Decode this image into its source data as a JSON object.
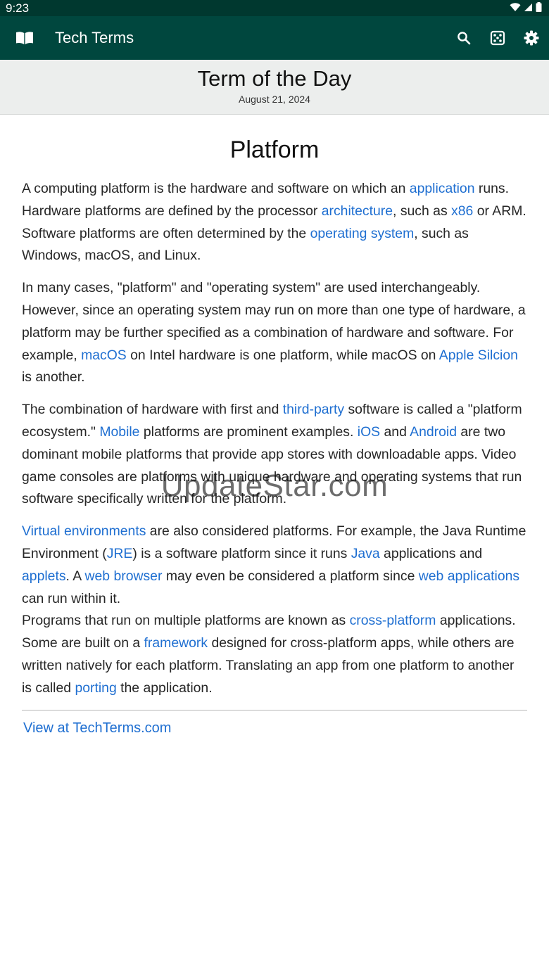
{
  "status_bar": {
    "time": "9:23",
    "wifi_icon": "wifi-icon",
    "signal_icon": "signal-icon",
    "battery_icon": "battery-icon"
  },
  "app_bar": {
    "title": "Tech Terms",
    "logo_icon": "book-icon",
    "actions": [
      "search-icon",
      "dice-icon",
      "gear-icon"
    ]
  },
  "header": {
    "title": "Term of the Day",
    "date": "August 21, 2024"
  },
  "term": {
    "title": "Platform",
    "p1": {
      "t1": "A computing platform is the hardware and software on which an ",
      "l1": "application",
      "t2": " runs. Hardware platforms are defined by the processor ",
      "l2": "architecture",
      "t3": ", such as ",
      "l3": "x86",
      "t4": " or ARM. Software platforms are often determined by the ",
      "l4": "operating system",
      "t5": ", such as Windows, macOS, and Linux."
    },
    "p2": {
      "t1": "In many cases, \"platform\" and \"operating system\" are used interchangeably. However, since an operating system may run on more than one type of hardware, a platform may be further specified as a combination of hardware and software. For example, ",
      "l1": "macOS",
      "t2": " on Intel hardware is one platform, while macOS on ",
      "l2": "Apple Silcion",
      "t3": " is another."
    },
    "p3": {
      "t1": "The combination of hardware with first and ",
      "l1": "third-party",
      "t2": " software is called a \"platform ecosystem.\" ",
      "l2": "Mobile",
      "t3": " platforms are prominent examples. ",
      "l3": "iOS",
      "t4": " and ",
      "l4": "Android",
      "t5": " are two dominant mobile platforms that provide app stores with downloadable apps. Video game consoles are platforms with unique hardware and operating systems that run software specifically written for the platform."
    },
    "p4": {
      "l1": "Virtual environments",
      "t1": " are also considered platforms. For example, the Java Runtime Environment (",
      "l2": "JRE",
      "t2": ") is a software platform since it runs ",
      "l3": "Java",
      "t3": " applications and ",
      "l4": "applets",
      "t4": ". A ",
      "l5": "web browser",
      "t5": " may even be considered a platform since ",
      "l6": "web applications",
      "t6": " can run within it."
    },
    "p5": {
      "t1": "Programs that run on multiple platforms are known as ",
      "l1": "cross-platform",
      "t2": " applications. Some are built on a ",
      "l2": "framework",
      "t3": " designed for cross-platform apps, while others are written natively for each platform. Translating an app from one platform to another is called ",
      "l3": "porting",
      "t4": " the application."
    },
    "view_link": "View at TechTerms.com"
  },
  "watermark": "UpdateStar.com",
  "colors": {
    "status_bar": "#00382f",
    "app_bar": "#00473e",
    "link": "#1f6fd1"
  }
}
